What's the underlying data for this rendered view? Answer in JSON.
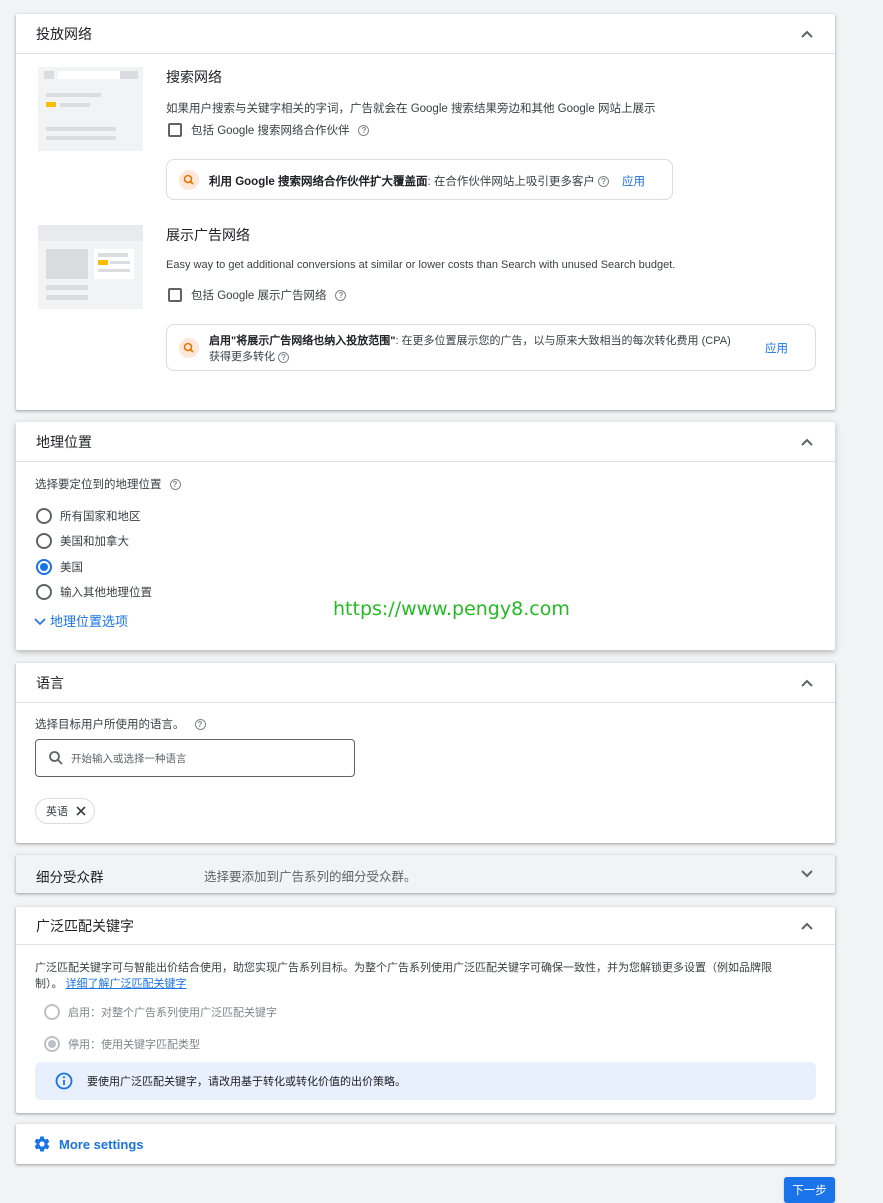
{
  "networks": {
    "title": "投放网络",
    "search": {
      "title": "搜索网络",
      "desc": "如果用户搜索与关键字相关的字词，广告就会在 Google 搜索结果旁边和其他 Google 网站上展示",
      "checkbox_label": "包括 Google 搜索网络合作伙伴",
      "promo_bold": "利用 Google 搜索网络合作伙伴扩大覆盖面",
      "promo_text": ": 在合作伙伴网站上吸引更多客户",
      "promo_apply": "应用"
    },
    "display": {
      "title": "展示广告网络",
      "desc": "Easy way to get additional conversions at similar or lower costs than Search with unused Search budget.",
      "checkbox_label": "包括 Google 展示广告网络",
      "promo_bold": "启用\"将展示广告网络也纳入投放范围\"",
      "promo_text": ": 在更多位置展示您的广告，以与原来大致相当的每次转化费用 (CPA)",
      "promo_text2": "获得更多转化",
      "promo_apply": "应用"
    }
  },
  "location": {
    "title": "地理位置",
    "prompt": "选择要定位到的地理位置",
    "options": [
      "所有国家和地区",
      "美国和加拿大",
      "美国",
      "输入其他地理位置"
    ],
    "selected_index": 2,
    "more_link": "地理位置选项",
    "watermark": "https://www.pengy8.com"
  },
  "language": {
    "title": "语言",
    "prompt": "选择目标用户所使用的语言。",
    "search_placeholder": "开始输入或选择一种语言",
    "chip": "英语"
  },
  "audience": {
    "title": "细分受众群",
    "desc": "选择要添加到广告系列的细分受众群。"
  },
  "broad_match": {
    "title": "广泛匹配关键字",
    "desc1": "广泛匹配关键字可与智能出价结合使用，助您实现广告系列目标。为整个广告系列使用广泛匹配关键字可确保一致性，并为您解锁更多设置（例如品牌限",
    "desc2": "制）。",
    "learn_more": "详细了解广泛匹配关键字",
    "option_on": "启用：对整个广告系列使用广泛匹配关键字",
    "option_off": "停用：使用关键字匹配类型",
    "info": "要使用广泛匹配关键字，请改用基于转化或转化价值的出价策略。"
  },
  "more_settings": {
    "label": "More settings"
  },
  "next_button": {
    "label": "下一步"
  },
  "colors": {
    "accent": "#1a73e8",
    "watermark": "#22bb22",
    "info_bg": "#e8f0fe"
  }
}
